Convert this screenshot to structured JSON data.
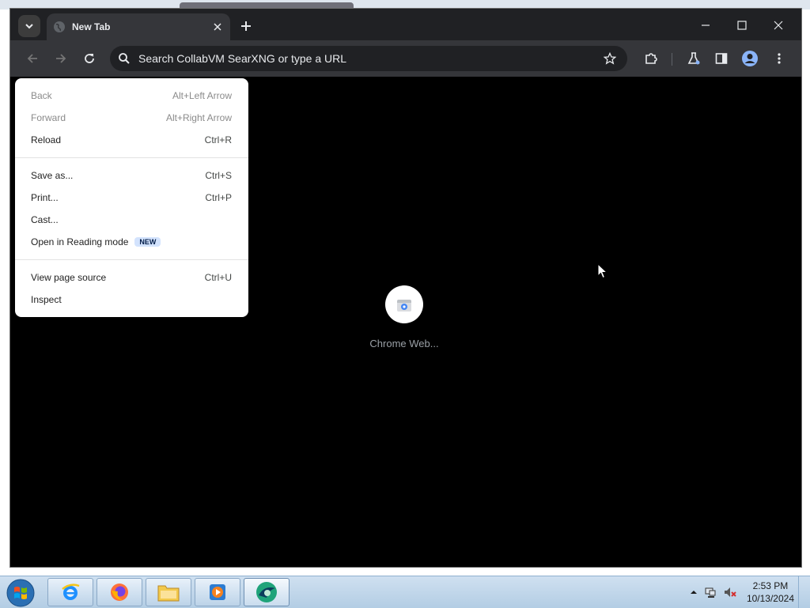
{
  "browser": {
    "tab_title": "New Tab",
    "omnibox_placeholder": "Search CollabVM SearXNG or type a URL"
  },
  "new_tab_page": {
    "shortcut_label": "Chrome Web..."
  },
  "context_menu": {
    "items": [
      {
        "label": "Back",
        "shortcut": "Alt+Left Arrow",
        "enabled": false
      },
      {
        "label": "Forward",
        "shortcut": "Alt+Right Arrow",
        "enabled": false
      },
      {
        "label": "Reload",
        "shortcut": "Ctrl+R",
        "enabled": true
      },
      {
        "label": "Save as...",
        "shortcut": "Ctrl+S",
        "enabled": true
      },
      {
        "label": "Print...",
        "shortcut": "Ctrl+P",
        "enabled": true
      },
      {
        "label": "Cast...",
        "shortcut": "",
        "enabled": true
      },
      {
        "label": "Open in Reading mode",
        "shortcut": "",
        "badge": "NEW",
        "enabled": true
      },
      {
        "label": "View page source",
        "shortcut": "Ctrl+U",
        "enabled": true
      },
      {
        "label": "Inspect",
        "shortcut": "",
        "enabled": true
      }
    ]
  },
  "taskbar": {
    "apps": [
      "internet-explorer-icon",
      "firefox-icon",
      "file-explorer-icon",
      "media-player-icon",
      "chrome-like-browser-icon"
    ],
    "clock_time": "2:53 PM",
    "clock_date": "10/13/2024"
  },
  "colors": {
    "titlebar": "#202124",
    "toolbar": "#35363a",
    "menu_bg": "#ffffff",
    "badge_bg": "#d3e3fd",
    "taskbar": "#b3cde4"
  }
}
